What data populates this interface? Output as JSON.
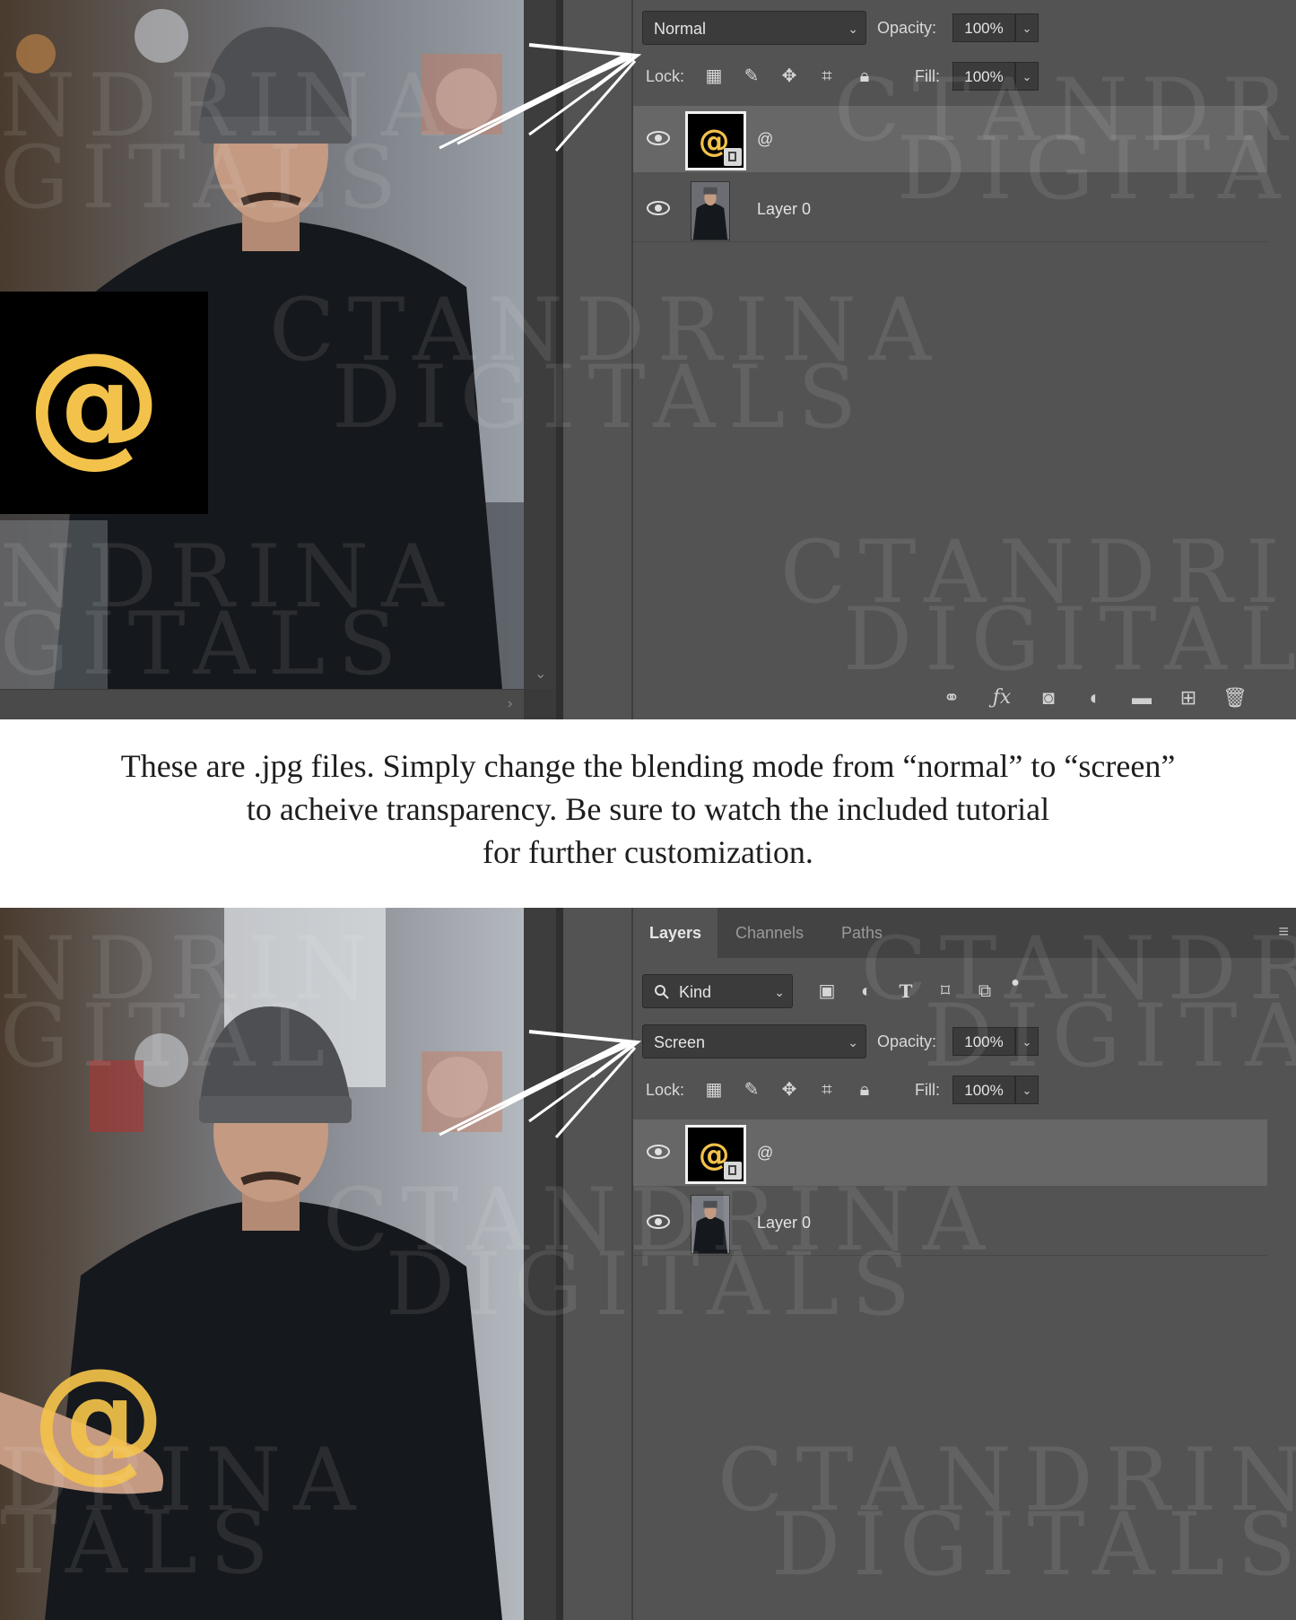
{
  "top_screenshot": {
    "blend_mode": "Normal",
    "opacity_label": "Opacity:",
    "opacity_value": "100%",
    "lock_label": "Lock:",
    "fill_label": "Fill:",
    "fill_value": "100%",
    "layers": [
      {
        "name": "@",
        "selected": true
      },
      {
        "name": "Layer 0",
        "selected": false
      }
    ]
  },
  "bottom_screenshot": {
    "tabs": [
      "Layers",
      "Channels",
      "Paths"
    ],
    "active_tab": "Layers",
    "filter_kind": "Kind",
    "blend_mode": "Screen",
    "opacity_label": "Opacity:",
    "opacity_value": "100%",
    "lock_label": "Lock:",
    "fill_label": "Fill:",
    "fill_value": "100%",
    "layers": [
      {
        "name": "@",
        "selected": true
      },
      {
        "name": "Layer 0",
        "selected": false
      }
    ]
  },
  "caption": {
    "line1": "These are .jpg files. Simply change the blending mode from “normal” to “screen”",
    "line2": "to acheive transparency. Be sure to watch the included tutorial",
    "line3": "for further customization."
  },
  "overlay_symbol": "@",
  "colors": {
    "panel_bg": "#535353",
    "selected_row": "#676767",
    "glow_gold": "#f3c24a",
    "caption_text": "#1e1e1e"
  }
}
